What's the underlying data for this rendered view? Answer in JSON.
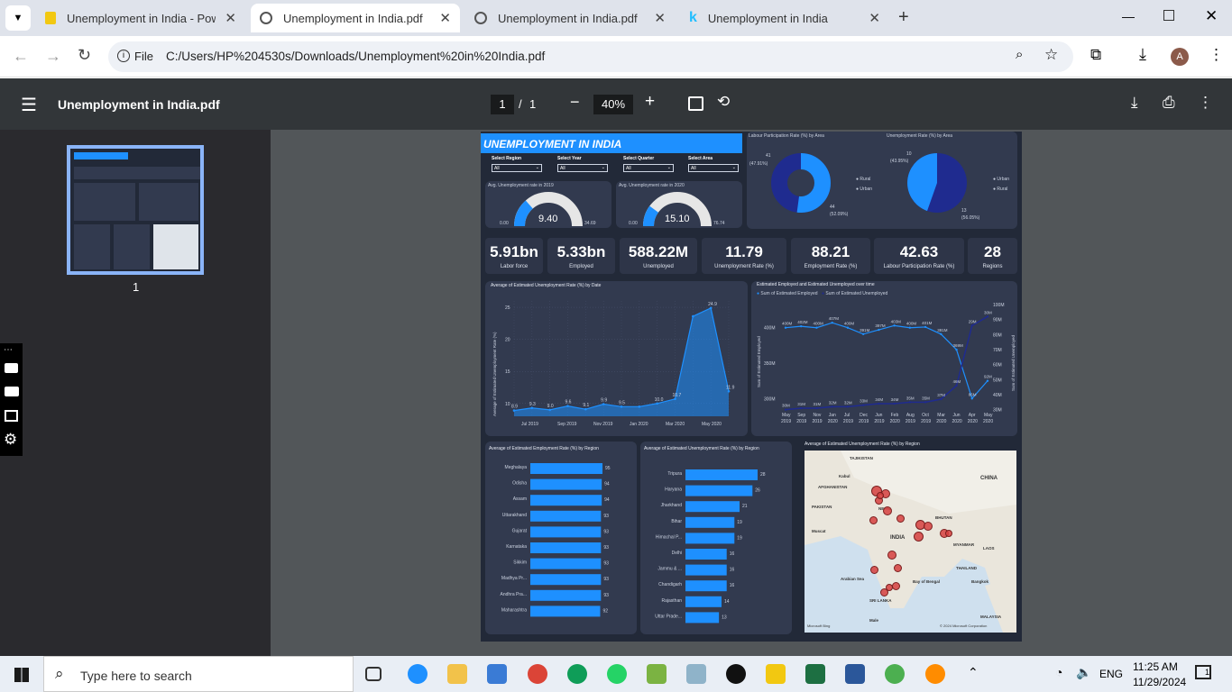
{
  "tabs": [
    {
      "title": "Unemployment in India - Power",
      "icon": "powerbi-icon"
    },
    {
      "title": "Unemployment in India.pdf",
      "icon": "globe-icon"
    },
    {
      "title": "Unemployment in India.pdf",
      "icon": "globe-icon"
    },
    {
      "title": "Unemployment in India",
      "icon": "kaggle-icon"
    }
  ],
  "address": {
    "scheme_label": "File",
    "url": "C:/Users/HP%204530s/Downloads/Unemployment%20in%20India.pdf"
  },
  "profile_initial": "A",
  "pdf": {
    "title": "Unemployment in India.pdf",
    "page_current": "1",
    "page_sep": "/",
    "page_total": "1",
    "zoom": "40%",
    "thumb_page_label": "1"
  },
  "report": {
    "title": "UNEMPLOYMENT IN INDIA",
    "slicers": [
      {
        "label": "Select Region",
        "value": "All"
      },
      {
        "label": "Select Year",
        "value": "All"
      },
      {
        "label": "Select Quarter",
        "value": "All"
      },
      {
        "label": "Select Area",
        "value": "All"
      }
    ],
    "gauges": [
      {
        "title": "Avg. Unemployment rate in 2019",
        "min": "0.00",
        "value": "9.40",
        "max": "34.69",
        "fill": 0.27
      },
      {
        "title": "Avg. Unemployment rate in 2020",
        "min": "0.00",
        "value": "15.10",
        "max": "76.74",
        "fill": 0.2
      }
    ],
    "donut1": {
      "title": "Labour Participation Rate (%) by Area",
      "labels": [
        {
          "v": "41",
          "p": "(47.91%)"
        },
        {
          "v": "44",
          "p": "(52.09%)"
        }
      ],
      "legend": [
        "Rural",
        "Urban"
      ]
    },
    "donut2": {
      "title": "Unemployment Rate (%) by Area",
      "labels": [
        {
          "v": "10",
          "p": "(43.95%)"
        },
        {
          "v": "13",
          "p": "(56.05%)"
        }
      ],
      "legend": [
        "Urban",
        "Rural"
      ]
    },
    "kpis": [
      {
        "value": "5.91bn",
        "label": "Labor force"
      },
      {
        "value": "5.33bn",
        "label": "Employed"
      },
      {
        "value": "588.22M",
        "label": "Unemployed"
      },
      {
        "value": "11.79",
        "label": "Unemployment Rate (%)"
      },
      {
        "value": "88.21",
        "label": "Employment Rate (%)"
      },
      {
        "value": "42.63",
        "label": "Labour Participation Rate (%)"
      },
      {
        "value": "28",
        "label": "Regions"
      }
    ],
    "area_title": "Average of Estimated Unemployment Rate (%) by Date",
    "area_ylabel": "Average of Estimated Unemployment Rate (%)",
    "combo_title": "Estimated Employed and Estimated Unemployed over time",
    "combo_legend": [
      "Sum of Estimated Employed",
      "Sum of Estimated Unemployed"
    ],
    "combo_ylabel_left": "Sum of Estimated Employed",
    "combo_ylabel_right": "Sum of Estimated Unemployed",
    "bar1_title": "Average of Estimated Employment Rate (%) by Region",
    "bar2_title": "Average of Estimated Unemployment Rate (%) by Region",
    "map_title": "Average of Estimated Unemployment Rate (%) by Region",
    "map_labels": [
      "TAJIKISTAN",
      "AFGHANISTAN",
      "PAKISTAN",
      "CHINA",
      "NEPAL",
      "INDIA",
      "MYANMAR",
      "THAILAND",
      "SRI LANKA",
      "MALAYSIA",
      "Kabul",
      "Bay of Bengal",
      "Arabian Sea",
      "Bangkok",
      "Muscat",
      "LAOS",
      "Male",
      "BHUTAN"
    ],
    "map_credit": "Microsoft Bing",
    "map_copyright": "© 2024 Microsoft Corporation"
  },
  "chart_data": [
    {
      "type": "area",
      "title": "Average of Estimated Unemployment Rate (%) by Date",
      "ylabel": "Average of Estimated Unemployment Rate (%)",
      "ylim": [
        8,
        26
      ],
      "yticks": [
        10,
        15,
        20,
        25
      ],
      "x": [
        "Jul 2019",
        "Sep 2019",
        "Nov 2019",
        "Jan 2020",
        "Mar 2020",
        "May 2020"
      ],
      "values": [
        8.9,
        9.3,
        9.0,
        9.6,
        9.1,
        9.9,
        9.5,
        9.5,
        10.0,
        10.7,
        23.6,
        24.9,
        11.9
      ],
      "labels": [
        "8.9",
        "9.3",
        "9.0",
        "9.6",
        "9.1",
        "9.9",
        "9.5",
        "10.0",
        "10.7",
        "24.9",
        "11.9"
      ]
    },
    {
      "type": "line",
      "title": "Estimated Employed and Estimated Unemployed over time",
      "x": [
        "May, 2019",
        "Sep, 2019",
        "Nov, 2019",
        "Jan, 2020",
        "Jul, 2019",
        "Dec, 2019",
        "Jun, 2019",
        "Feb, 2020",
        "Aug, 2019",
        "Oct, 2019",
        "Mar, 2020",
        "Jun, 2020",
        "Apr, 2020",
        "May, 2020"
      ],
      "yticks_left": [
        "300M",
        "350M",
        "400M"
      ],
      "yticks_right": [
        "30M",
        "40M",
        "50M",
        "60M",
        "70M",
        "80M",
        "90M",
        "100M"
      ],
      "series": [
        {
          "name": "Sum of Estimated Employed",
          "labels": [
            "400M",
            "402M",
            "400M",
            "407M",
            "400M",
            "391M",
            "397M",
            "403M",
            "400M",
            "401M",
            "391M",
            "369M",
            "86M",
            "92M"
          ],
          "values": [
            400,
            402,
            400,
            407,
            400,
            391,
            397,
            403,
            400,
            401,
            391,
            369,
            300,
            325
          ]
        },
        {
          "name": "Sum of Estimated Unemployed",
          "labels": [
            "30M",
            "31M",
            "31M",
            "32M",
            "32M",
            "33M",
            "34M",
            "34M",
            "35M",
            "35M",
            "37M",
            "46M",
            "29M",
            "30M"
          ],
          "values": [
            30,
            31,
            31,
            32,
            32,
            33,
            34,
            34,
            35,
            35,
            37,
            46,
            86,
            92
          ]
        }
      ]
    },
    {
      "type": "bar",
      "title": "Average of Estimated Employment Rate (%) by Region",
      "categories": [
        "Meghalaya",
        "Odisha",
        "Assam",
        "Uttarakhand",
        "Gujarat",
        "Karnataka",
        "Sikkim",
        "Madhya Pr...",
        "Andhra Pra...",
        "Maharashtra"
      ],
      "values": [
        95,
        94,
        94,
        93,
        93,
        93,
        93,
        93,
        93,
        92
      ]
    },
    {
      "type": "bar",
      "title": "Average of Estimated Unemployment Rate (%) by Region",
      "categories": [
        "Tripura",
        "Haryana",
        "Jharkhand",
        "Bihar",
        "Himachal P...",
        "Delhi",
        "Jammu & ...",
        "Chandigarh",
        "Rajasthan",
        "Uttar Prade..."
      ],
      "values": [
        28,
        26,
        21,
        19,
        19,
        16,
        16,
        16,
        14,
        13
      ]
    }
  ],
  "taskbar": {
    "search_placeholder": "Type here to search",
    "lang": "ENG",
    "time": "11:25 AM",
    "date": "11/29/2024",
    "notif_count": "1"
  }
}
